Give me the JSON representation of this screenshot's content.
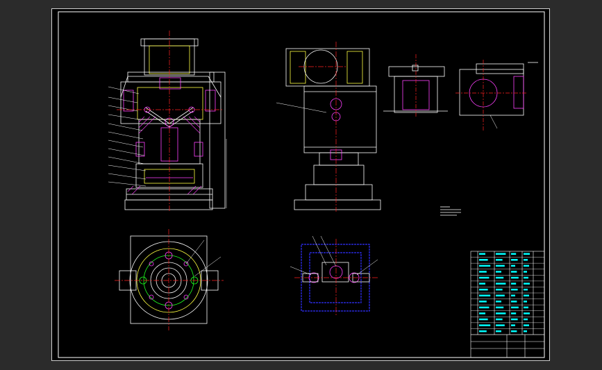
{
  "colors": {
    "background": "#000000",
    "outline": "#ffffff",
    "centerline": "#ff2020",
    "hatch": "#ff40ff",
    "construction": "#ffff40",
    "dimension": "#00ffff",
    "part_green": "#20ff20",
    "part_blue": "#3030ff"
  },
  "views": {
    "front_section": "front-sectional-view",
    "side_view": "side-elevation-view",
    "detail_a": "detail-section-a",
    "detail_b": "detail-section-b",
    "plan_view": "top-plan-view",
    "mechanism_plan": "mechanism-plan-view"
  },
  "title_block": {
    "rows": 14,
    "columns": 6
  }
}
